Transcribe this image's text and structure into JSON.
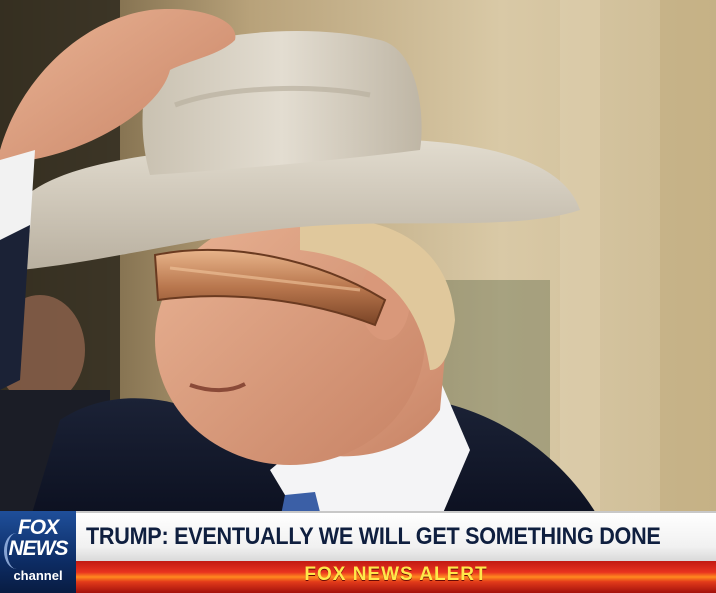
{
  "logo": {
    "line1": "FOX",
    "line2": "NEWS",
    "line3": "channel"
  },
  "headline": "TRUMP: EVENTUALLY WE WILL GET SOMETHING DONE",
  "alert": "FOX NEWS ALERT",
  "colors": {
    "headline_text": "#0f1f3f",
    "logo_bg": "#1f4f9a",
    "alert_bg": "#e8331f",
    "alert_text": "#ffe84a",
    "hat": "#d9d2c3",
    "visor": "#c98a5f"
  }
}
